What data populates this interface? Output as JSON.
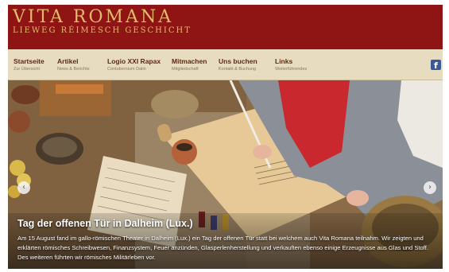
{
  "site": {
    "title": "VITA ROMANA",
    "subtitle": "LIEWEG RÉIMESCH GESCHICHT"
  },
  "nav": {
    "items": [
      {
        "label": "Startseite",
        "sub": "Zur Übersicht"
      },
      {
        "label": "Artikel",
        "sub": "News & Berichte"
      },
      {
        "label": "Logio XXI Rapax",
        "sub": "Contubernium Dalrii"
      },
      {
        "label": "Mitmachen",
        "sub": "Mitgliedschaft"
      },
      {
        "label": "Uns buchen",
        "sub": "Kontakt & Buchung"
      },
      {
        "label": "Links",
        "sub": "Weiterführendes"
      }
    ],
    "social_icon": "facebook-icon",
    "social_glyph": "f"
  },
  "slider": {
    "prev_glyph": "‹",
    "next_glyph": "›",
    "caption_title": "Tag der offenen Tür in Dalheim (Lux.)",
    "caption_text": "Am 15 August fand im gallo-römischen Theater in Dalheim (Lux.) ein Tag der offenen Tür statt bei welchem auch Vita Romana teilnahm. Wir zeigten und erklärten römisches Schreibwesen, Finanzsystem, Feuer anzünden, Glasperlenherstellung und verkauften ebenso einige Erzeugnisse aus Glas und Stoff. Des weiteren führten wir römisches Militärleben vor."
  },
  "colors": {
    "header_bg": "#8f1515",
    "brand_gold": "#e3ba6c",
    "nav_bg": "#e8dcc0",
    "nav_text": "#5b2a14",
    "facebook_blue": "#3b5998"
  }
}
